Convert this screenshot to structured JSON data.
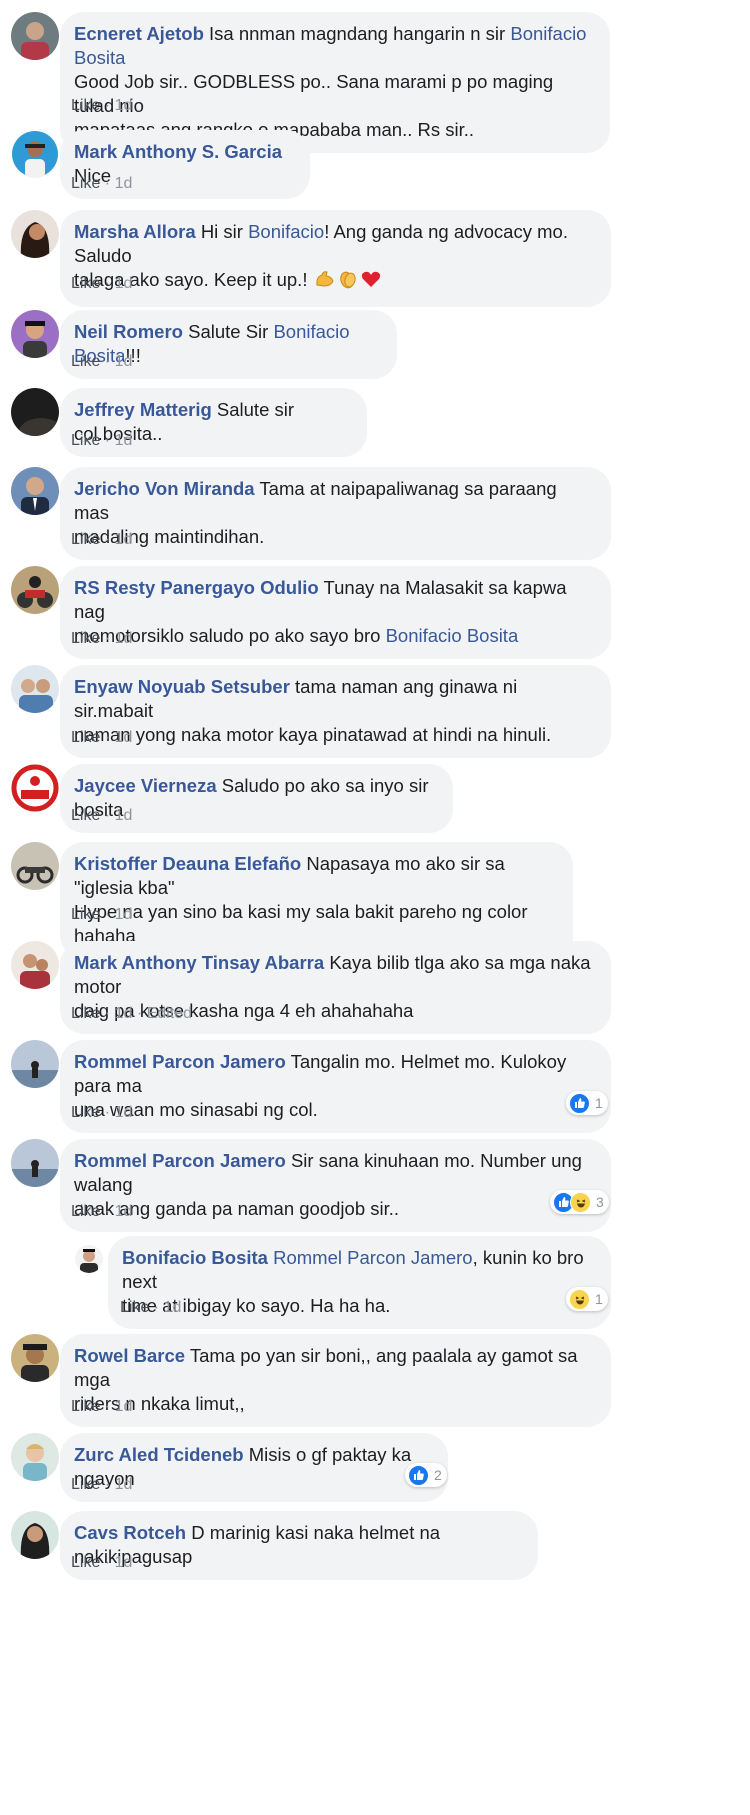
{
  "colors": {
    "link": "#385898",
    "bubble": "#f2f3f5",
    "meta": "#90949c",
    "like_reaction": "#1877f2",
    "haha_reaction": "#f7d44c"
  },
  "comments": [
    {
      "author": "Ecneret Ajetob",
      "text1": "Isa nnman magndang hangarin n sir ",
      "mention": "Bonifacio Bosita",
      "line2": "Good Job sir.. GODBLESS po.. Sana marami p po maging tulad nio",
      "line3": "mapataas ang rangko o mapababa man.. Rs sir..",
      "like": "Like",
      "time": "1d"
    },
    {
      "author": "Mark Anthony S. Garcia",
      "text1": "Nice",
      "like": "Like",
      "time": "1d"
    },
    {
      "author": "Marsha Allora",
      "text1": "Hi sir ",
      "mention": "Bonifacio",
      "text2": "! Ang ganda ng advocacy mo. Saludo",
      "line2": "talaga ako sayo. Keep it up.!",
      "emojis": [
        "flexed-biceps-icon",
        "clapping-hands-icon",
        "red-heart-icon"
      ],
      "like": "Like",
      "time": "1d"
    },
    {
      "author": "Neil Romero",
      "text1": "Salute Sir ",
      "mention": "Bonifacio Bosita",
      "text2": "!!!",
      "like": "Like",
      "time": "1d"
    },
    {
      "author": "Jeffrey Matterig",
      "text1": "Salute sir col.bosita..",
      "like": "Like",
      "time": "1d"
    },
    {
      "author": "Jericho Von Miranda",
      "text1": "Tama at naipapaliwanag sa paraang mas",
      "line2": "madaling maintindihan.",
      "like": "Like",
      "time": "1d"
    },
    {
      "author": "RS Resty Panergayo Odulio",
      "text1": "Tunay na Malasakit sa kapwa nag",
      "line2": "momotorsiklo saludo po ako sayo bro ",
      "mention": "Bonifacio Bosita",
      "like": "Like",
      "time": "1d"
    },
    {
      "author": "Enyaw Noyuab Setsuber",
      "text1": "tama naman ang ginawa ni sir.mabait",
      "line2": "naman yong naka motor kaya pinatawad at hindi na hinuli.",
      "like": "Like",
      "time": "1d"
    },
    {
      "author": "Jaycee Vierneza",
      "text1": "Saludo po ako sa inyo sir bosita",
      "like": "Like",
      "time": "1d"
    },
    {
      "author": "Kristoffer Deauna Elefaño",
      "text1": "Napasaya mo ako sir sa \"iglesia kba\"",
      "line2": "Hype na yan sino ba kasi my sala bakit pareho ng color hahaha",
      "like": "Like",
      "time": "1d"
    },
    {
      "author": "Mark Anthony Tinsay Abarra",
      "text1": "Kaya bilib tlga ako sa mga naka motor",
      "line2": "daig pa kotse kasha nga 4 eh ahahahaha",
      "like": "Like",
      "time": "1d",
      "edited": "Edited"
    },
    {
      "author": "Rommel Parcon Jamero",
      "text1": "Tangalin mo. Helmet mo. Kulokoy para ma",
      "line2": "una waan mo sinasabi ng col.",
      "like": "Like",
      "time": "1d",
      "reaction_count": "1"
    },
    {
      "author": "Rommel Parcon Jamero",
      "text1": "Sir sana kinuhaan mo. Number ung walang",
      "line2": "anak ang ganda pa naman goodjob sir..",
      "like": "Like",
      "time": "1d",
      "reaction_count": "3"
    },
    {
      "author": "Bonifacio Bosita",
      "mention": "Rommel Parcon Jamero",
      "text2": ", kunin ko bro next",
      "line2": "time at ibigay ko sayo. Ha ha ha.",
      "like": "Like",
      "time": "1d",
      "reaction_count": "1"
    },
    {
      "author": "Rowel Barce",
      "text1": "Tama po yan sir boni,, ang paalala ay gamot sa mga",
      "line2": "riders n nkaka limut,,",
      "like": "Like",
      "time": "1d"
    },
    {
      "author": "Zurc Aled Tcideneb",
      "text1": "Misis o gf paktay ka ngayon",
      "like": "Like",
      "time": "1d",
      "reaction_count": "2"
    },
    {
      "author": "Cavs Rotceh",
      "text1": "D marinig kasi naka helmet na nakikipagusap",
      "like": "Like",
      "time": "1d"
    }
  ]
}
